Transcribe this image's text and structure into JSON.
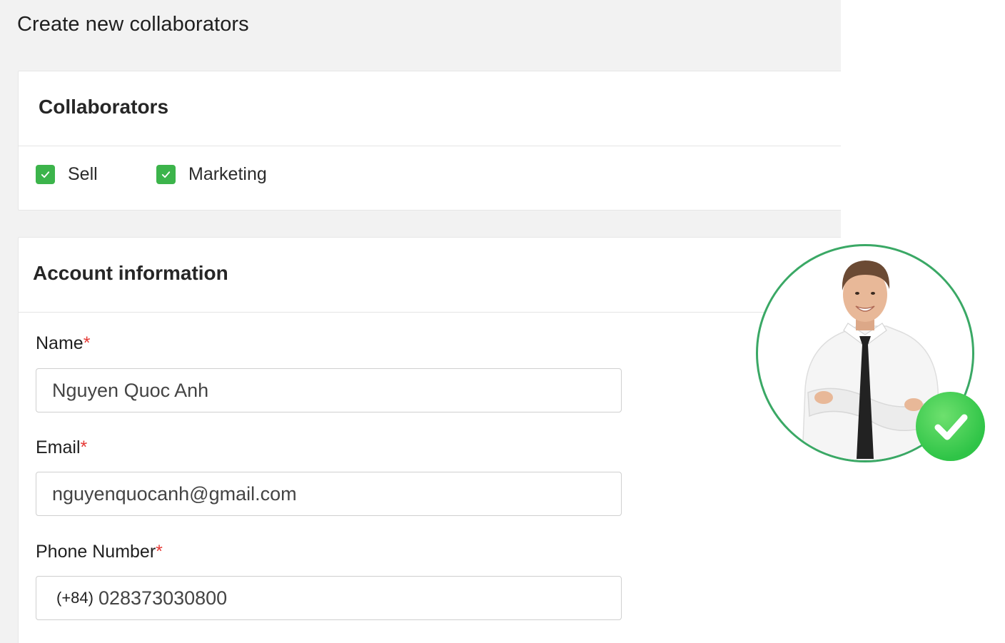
{
  "page": {
    "title": "Create new collaborators"
  },
  "collaborators": {
    "heading": "Collaborators",
    "options": [
      {
        "label": "Sell",
        "checked": true
      },
      {
        "label": "Marketing",
        "checked": true
      }
    ],
    "check_color": "#3cb44b"
  },
  "account": {
    "heading": "Account information",
    "fields": {
      "name": {
        "label": "Name",
        "required_mark": "*",
        "value": "Nguyen Quoc Anh"
      },
      "email": {
        "label": "Email",
        "required_mark": "*",
        "value": "nguyenquocanh@gmail.com"
      },
      "phone": {
        "label": "Phone Number",
        "required_mark": "*",
        "prefix": "(+84)",
        "value": "028373030800"
      }
    }
  },
  "avatar": {
    "icon": "person-photo",
    "badge_icon": "verified-check-icon",
    "ring_color": "#3aa865",
    "badge_color": "#2fc447"
  }
}
